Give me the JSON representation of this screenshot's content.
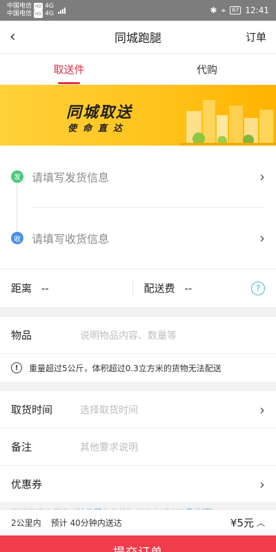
{
  "status_bar": {
    "carrier1": "中国电信",
    "carrier2": "中国电信",
    "network1": "4G",
    "network2": "4G",
    "battery": "67",
    "time": "12:41"
  },
  "nav": {
    "back_icon": "chevron-left-icon",
    "title": "同城跑腿",
    "orders_label": "订单"
  },
  "tabs": [
    {
      "label": "取送件",
      "active": true
    },
    {
      "label": "代购",
      "active": false
    }
  ],
  "banner": {
    "title": "同城取送",
    "subtitle": "使命直达"
  },
  "address": {
    "send_badge": "发",
    "send_placeholder": "请填写发货信息",
    "recv_badge": "收",
    "recv_placeholder": "请填写收货信息"
  },
  "distance": {
    "label": "距离",
    "value": "--",
    "fee_label": "配送费",
    "fee_value": "--",
    "help_icon": "?"
  },
  "goods": {
    "label": "物品",
    "placeholder": "说明物品内容、数量等",
    "notice": "重量超过5公斤，体积超过0.3立方米的货物无法配送"
  },
  "options": {
    "pickup_label": "取货时间",
    "pickup_placeholder": "选择取货时间",
    "remark_label": "备注",
    "remark_placeholder": "其他要求说明",
    "coupon_label": "优惠券"
  },
  "agreement": {
    "prefix": "下单即代表同意",
    "link1": "《快件服务条款》",
    "middle": "并遵守",
    "link2": "《违禁品说明》"
  },
  "bottom": {
    "range": "2公里内",
    "estimate": "预计 40分钟内送达",
    "price": "¥5元",
    "submit_label": "提交订单"
  },
  "colors": {
    "accent": "#e0314b",
    "submit": "#f03c4b",
    "send_dot": "#4cc87a",
    "recv_dot": "#4a90e2",
    "banner": "#ffc21a"
  }
}
